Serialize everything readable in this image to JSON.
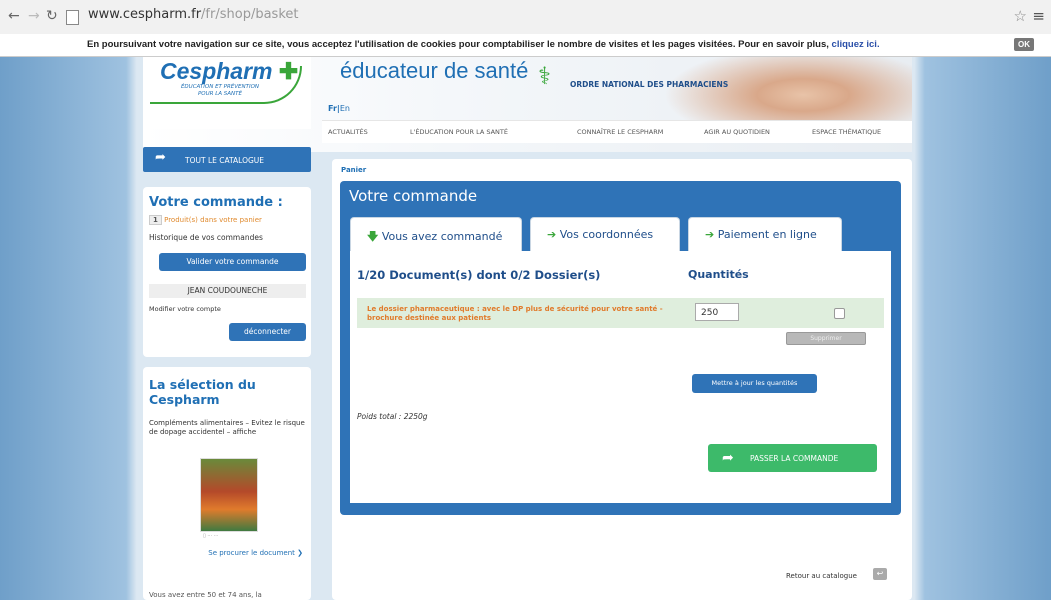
{
  "browser": {
    "url_domain": "www.cespharm.fr",
    "url_path": "/fr/shop/basket"
  },
  "cookie_banner": {
    "text": "En poursuivant votre navigation sur ce site, vous acceptez l'utilisation de cookies pour comptabiliser le nombre de visites et les pages visitées. Pour en savoir plus,",
    "link": "cliquez ici.",
    "ok": "OK"
  },
  "header": {
    "logo": "Cespharm",
    "logo_cross": "✚",
    "logo_sub_1": "ÉDUCATION ET PRÉVENTION",
    "logo_sub_2": "POUR LA SANTÉ",
    "title": "éducateur de santé",
    "ordre": "ORDRE NATIONAL DES PHARMACIENS",
    "lang_fr": "Fr",
    "lang_en": "En",
    "nav": [
      "ACTUALITÉS",
      "L'ÉDUCATION POUR LA SANTÉ",
      "CONNAÎTRE LE CESPHARM",
      "AGIR AU QUOTIDIEN",
      "ESPACE THÉMATIQUE"
    ]
  },
  "sidebar": {
    "catalogue": "TOUT LE CATALOGUE",
    "order_title": "Votre commande :",
    "count": "1",
    "count_text": "Produit(s) dans votre panier",
    "history": "Historique de vos commandes",
    "validate": "Valider votre commande",
    "user": "JEAN COUDOUNECHE",
    "modify": "Modifier votre compte",
    "logout": "déconnecter",
    "selection_title": "La sélection du Cespharm",
    "selection_desc": "Compléments alimentaires – Evitez le risque de dopage accidentel – affiche",
    "procure": "Se procurer le document",
    "more": "Vous avez entre 50 et 74 ans, la"
  },
  "main": {
    "breadcrumb": "Panier",
    "title": "Votre commande",
    "tabs": [
      {
        "arrow": "🡇",
        "label": "Vous avez commandé"
      },
      {
        "arrow": "➔",
        "label": "Vos coordonnées"
      },
      {
        "arrow": "➔",
        "label": "Paiement en ligne"
      }
    ],
    "doc_header": "1/20 Document(s) dont 0/2 Dossier(s)",
    "qty_header": "Quantités",
    "item": {
      "name": "Le dossier pharmaceutique : avec le DP plus de sécurité pour votre santé - brochure destinée aux patients",
      "quantity": "250"
    },
    "delete": "Supprimer",
    "update": "Mettre à jour les quantités",
    "weight": "Poids total : 2250g",
    "checkout": "PASSER LA COMMANDE",
    "back": "Retour au catalogue"
  },
  "colors": {
    "brand_blue": "#2f73b7",
    "brand_green": "#3aa63a",
    "checkout_green": "#3dba6a",
    "item_orange": "#e07b2c"
  }
}
